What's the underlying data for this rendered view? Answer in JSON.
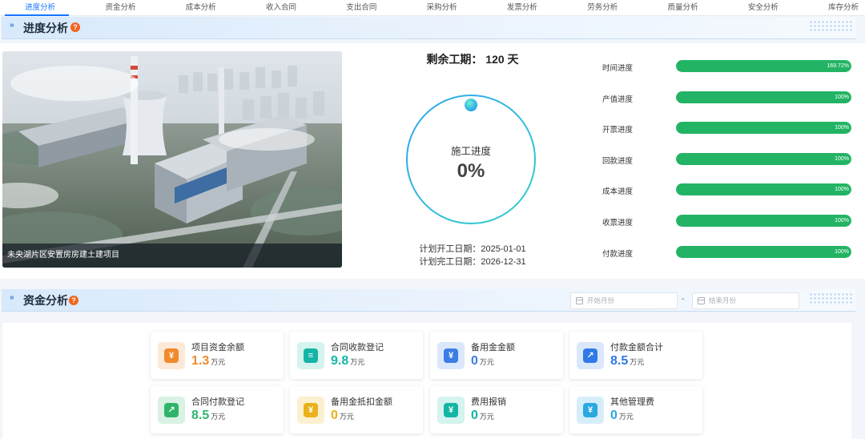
{
  "tabs": [
    {
      "label": "进度分析",
      "active": true
    },
    {
      "label": "资金分析",
      "active": false
    },
    {
      "label": "成本分析",
      "active": false
    },
    {
      "label": "收入合同",
      "active": false
    },
    {
      "label": "支出合同",
      "active": false
    },
    {
      "label": "采购分析",
      "active": false
    },
    {
      "label": "发票分析",
      "active": false
    },
    {
      "label": "劳务分析",
      "active": false
    },
    {
      "label": "质量分析",
      "active": false
    },
    {
      "label": "安全分析",
      "active": false
    },
    {
      "label": "库存分析",
      "active": false
    }
  ],
  "progress_section": {
    "title": "进度分析",
    "help_icon": "question-icon",
    "project_caption": "未央湖片区安置房房建土建项目",
    "remaining": "剩余工期： 120 天",
    "ring_label": "施工进度",
    "ring_value": "0%",
    "ring_fraction": 0,
    "plan_start": "计划开工日期：2025-01-01",
    "plan_end": "计划完工日期：2026-12-31",
    "bars": [
      {
        "label": "时间进度",
        "pct_text": "169.72%",
        "fraction": 1.0
      },
      {
        "label": "产值进度",
        "pct_text": "100%",
        "fraction": 1.0
      },
      {
        "label": "开票进度",
        "pct_text": "100%",
        "fraction": 1.0
      },
      {
        "label": "回款进度",
        "pct_text": "100%",
        "fraction": 1.0
      },
      {
        "label": "成本进度",
        "pct_text": "100%",
        "fraction": 1.0
      },
      {
        "label": "收票进度",
        "pct_text": "100%",
        "fraction": 1.0
      },
      {
        "label": "付款进度",
        "pct_text": "100%",
        "fraction": 1.0
      }
    ],
    "bar_color": "#22b464"
  },
  "finance_section": {
    "title": "资金分析",
    "start_placeholder": "开始月份",
    "end_placeholder": "结束月份",
    "separator": "-",
    "unit": "万元",
    "cards": [
      {
        "label": "项目资金余额",
        "value": "1.3",
        "color": "#f08a2c",
        "icon": "fund-balance-icon",
        "icon_bg": "#fde9d8",
        "glyph": "¥"
      },
      {
        "label": "合同收款登记",
        "value": "9.8",
        "color": "#13b5a5",
        "icon": "contract-receipt-icon",
        "icon_bg": "#d5f3ef",
        "glyph": "≡"
      },
      {
        "label": "备用金金额",
        "value": "0",
        "color": "#3c7de6",
        "icon": "reserve-fund-icon",
        "icon_bg": "#dbe7fb",
        "glyph": "¥"
      },
      {
        "label": "付款金额合计",
        "value": "8.5",
        "color": "#2f7ae5",
        "icon": "payment-total-icon",
        "icon_bg": "#dbe7fb",
        "glyph": "↗"
      },
      {
        "label": "合同付款登记",
        "value": "8.5",
        "color": "#2fb56b",
        "icon": "contract-payment-icon",
        "icon_bg": "#d9f2e3",
        "glyph": "↗"
      },
      {
        "label": "备用金抵扣金额",
        "value": "0",
        "color": "#e9b21c",
        "icon": "reserve-deduct-icon",
        "icon_bg": "#fbf0cf",
        "glyph": "¥"
      },
      {
        "label": "费用报销",
        "value": "0",
        "color": "#13b5a5",
        "icon": "expense-reimburse-icon",
        "icon_bg": "#d5f3ef",
        "glyph": "¥"
      },
      {
        "label": "其他管理费",
        "value": "0",
        "color": "#29a9e0",
        "icon": "other-fee-icon",
        "icon_bg": "#d6eefa",
        "glyph": "¥"
      }
    ]
  }
}
